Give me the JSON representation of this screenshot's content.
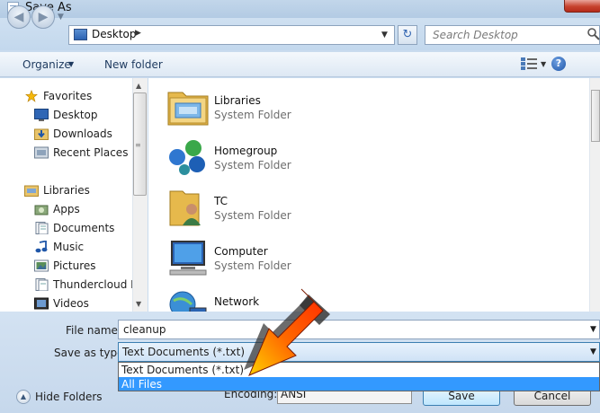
{
  "window": {
    "title": "Save As"
  },
  "address": {
    "location": "Desktop"
  },
  "search": {
    "placeholder": "Search Desktop"
  },
  "toolbar": {
    "organize": "Organize",
    "new_folder": "New folder"
  },
  "nav": {
    "favorites": {
      "label": "Favorites",
      "items": [
        "Desktop",
        "Downloads",
        "Recent Places"
      ]
    },
    "libraries": {
      "label": "Libraries",
      "items": [
        "Apps",
        "Documents",
        "Music",
        "Pictures",
        "Thundercloud N",
        "Videos"
      ]
    }
  },
  "files": [
    {
      "name": "Libraries",
      "type": "System Folder",
      "icon": "libraries-icon"
    },
    {
      "name": "Homegroup",
      "type": "System Folder",
      "icon": "homegroup-icon"
    },
    {
      "name": "TC",
      "type": "System Folder",
      "icon": "user-folder-icon"
    },
    {
      "name": "Computer",
      "type": "System Folder",
      "icon": "computer-icon"
    },
    {
      "name": "Network",
      "type": "",
      "icon": "network-icon"
    }
  ],
  "form": {
    "file_name_label": "File name:",
    "file_name_value": "cleanup",
    "save_as_type_label": "Save as type:",
    "save_as_type_value": "Text Documents (*.txt)",
    "type_options": [
      "Text Documents (*.txt)",
      "All Files"
    ],
    "selected_option_index": 1,
    "encoding_label": "Encoding:",
    "encoding_value": "ANSI"
  },
  "buttons": {
    "hide_folders": "Hide Folders",
    "save": "Save",
    "cancel": "Cancel"
  },
  "colors": {
    "selection": "#3399ff",
    "arrow_top": "#ff2a00",
    "arrow_bottom": "#ffd000"
  }
}
